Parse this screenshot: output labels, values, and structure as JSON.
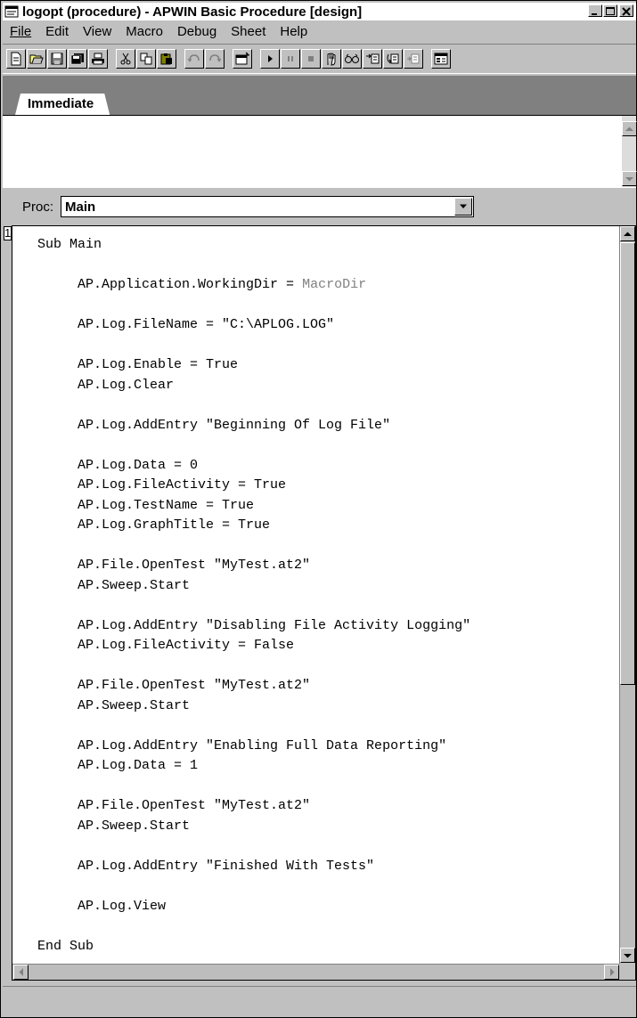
{
  "window": {
    "title": "logopt (procedure) - APWIN Basic Procedure [design]"
  },
  "menu": [
    {
      "label": "File"
    },
    {
      "label": "Edit"
    },
    {
      "label": "View"
    },
    {
      "label": "Macro"
    },
    {
      "label": "Debug"
    },
    {
      "label": "Sheet"
    },
    {
      "label": "Help"
    }
  ],
  "toolbar": {
    "buttons": [
      "new-icon",
      "open-icon",
      "save-icon",
      "save-all-icon",
      "print-icon",
      "cut-icon",
      "copy-icon",
      "paste-icon",
      "undo-icon",
      "redo-icon",
      "dialog-editor-icon",
      "run-icon",
      "pause-icon",
      "stop-icon",
      "toggle-breakpoint-icon",
      "watch-icon",
      "step-into-icon",
      "step-over-icon",
      "calls-icon",
      "object-browser-icon"
    ]
  },
  "tabs": {
    "active": "Immediate"
  },
  "proc": {
    "label": "Proc:",
    "selected": "Main"
  },
  "editor": {
    "line_number": "1",
    "lines": [
      "Sub Main",
      "",
      "     AP.Application.WorkingDir = MacroDir",
      "",
      "     AP.Log.FileName = \"C:\\APLOG.LOG\"",
      "",
      "     AP.Log.Enable = True",
      "     AP.Log.Clear",
      "",
      "     AP.Log.AddEntry \"Beginning Of Log File\"",
      "",
      "     AP.Log.Data = 0",
      "     AP.Log.FileActivity = True",
      "     AP.Log.TestName = True",
      "     AP.Log.GraphTitle = True",
      "",
      "     AP.File.OpenTest \"MyTest.at2\"",
      "     AP.Sweep.Start",
      "",
      "     AP.Log.AddEntry \"Disabling File Activity Logging\"",
      "     AP.Log.FileActivity = False",
      "",
      "     AP.File.OpenTest \"MyTest.at2\"",
      "     AP.Sweep.Start",
      "",
      "     AP.Log.AddEntry \"Enabling Full Data Reporting\"",
      "     AP.Log.Data = 1",
      "",
      "     AP.File.OpenTest \"MyTest.at2\"",
      "     AP.Sweep.Start",
      "",
      "     AP.Log.AddEntry \"Finished With Tests\"",
      "",
      "     AP.Log.View",
      "",
      "End Sub"
    ]
  },
  "colors": {
    "background": "#c0c0c0",
    "title_bar": "#ffffff",
    "tab_strip": "#808080",
    "macro_keyword": "#808080"
  }
}
